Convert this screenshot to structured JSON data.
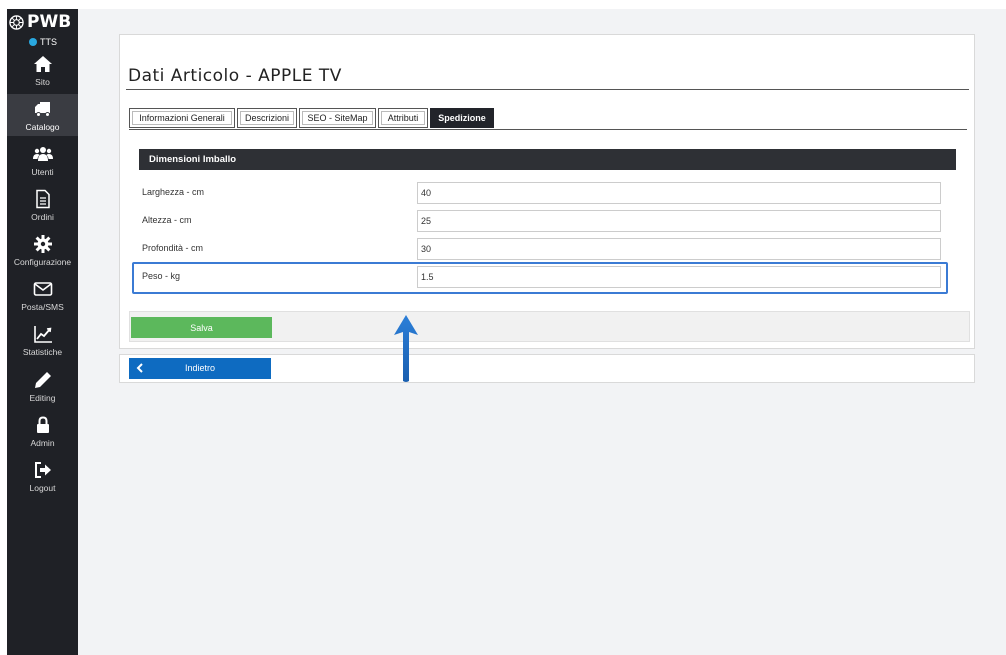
{
  "sidebar": {
    "brand": "PWB",
    "status": "TTS",
    "items": [
      {
        "label": "Sito",
        "icon": "home-icon"
      },
      {
        "label": "Catalogo",
        "icon": "truck-icon",
        "active": true
      },
      {
        "label": "Utenti",
        "icon": "users-icon"
      },
      {
        "label": "Ordini",
        "icon": "document-icon"
      },
      {
        "label": "Configurazione",
        "icon": "gear-icon"
      },
      {
        "label": "Posta/SMS",
        "icon": "envelope-icon"
      },
      {
        "label": "Statistiche",
        "icon": "chart-icon"
      },
      {
        "label": "Editing",
        "icon": "pencil-icon"
      },
      {
        "label": "Admin",
        "icon": "lock-icon"
      },
      {
        "label": "Logout",
        "icon": "logout-icon"
      }
    ]
  },
  "page": {
    "title": "Dati Articolo - APPLE TV"
  },
  "tabs": [
    {
      "label": "Informazioni Generali"
    },
    {
      "label": "Descrizioni"
    },
    {
      "label": "SEO - SiteMap"
    },
    {
      "label": "Attributi"
    },
    {
      "label": "Spedizione",
      "active": true
    }
  ],
  "section": {
    "title": "Dimensioni Imballo",
    "fields": [
      {
        "label": "Larghezza - cm",
        "value": "40"
      },
      {
        "label": "Altezza - cm",
        "value": "25"
      },
      {
        "label": "Profondità - cm",
        "value": "30"
      },
      {
        "label": "Peso - kg",
        "value": "1.5"
      }
    ]
  },
  "actions": {
    "save_label": "Salva",
    "back_label": "Indietro"
  },
  "colors": {
    "sidebar_bg": "#1f2126",
    "accent_blue": "#0e6bc1",
    "save_green": "#5cb85c",
    "highlight": "#3b7bd4",
    "status_dot": "#29a8e0"
  }
}
